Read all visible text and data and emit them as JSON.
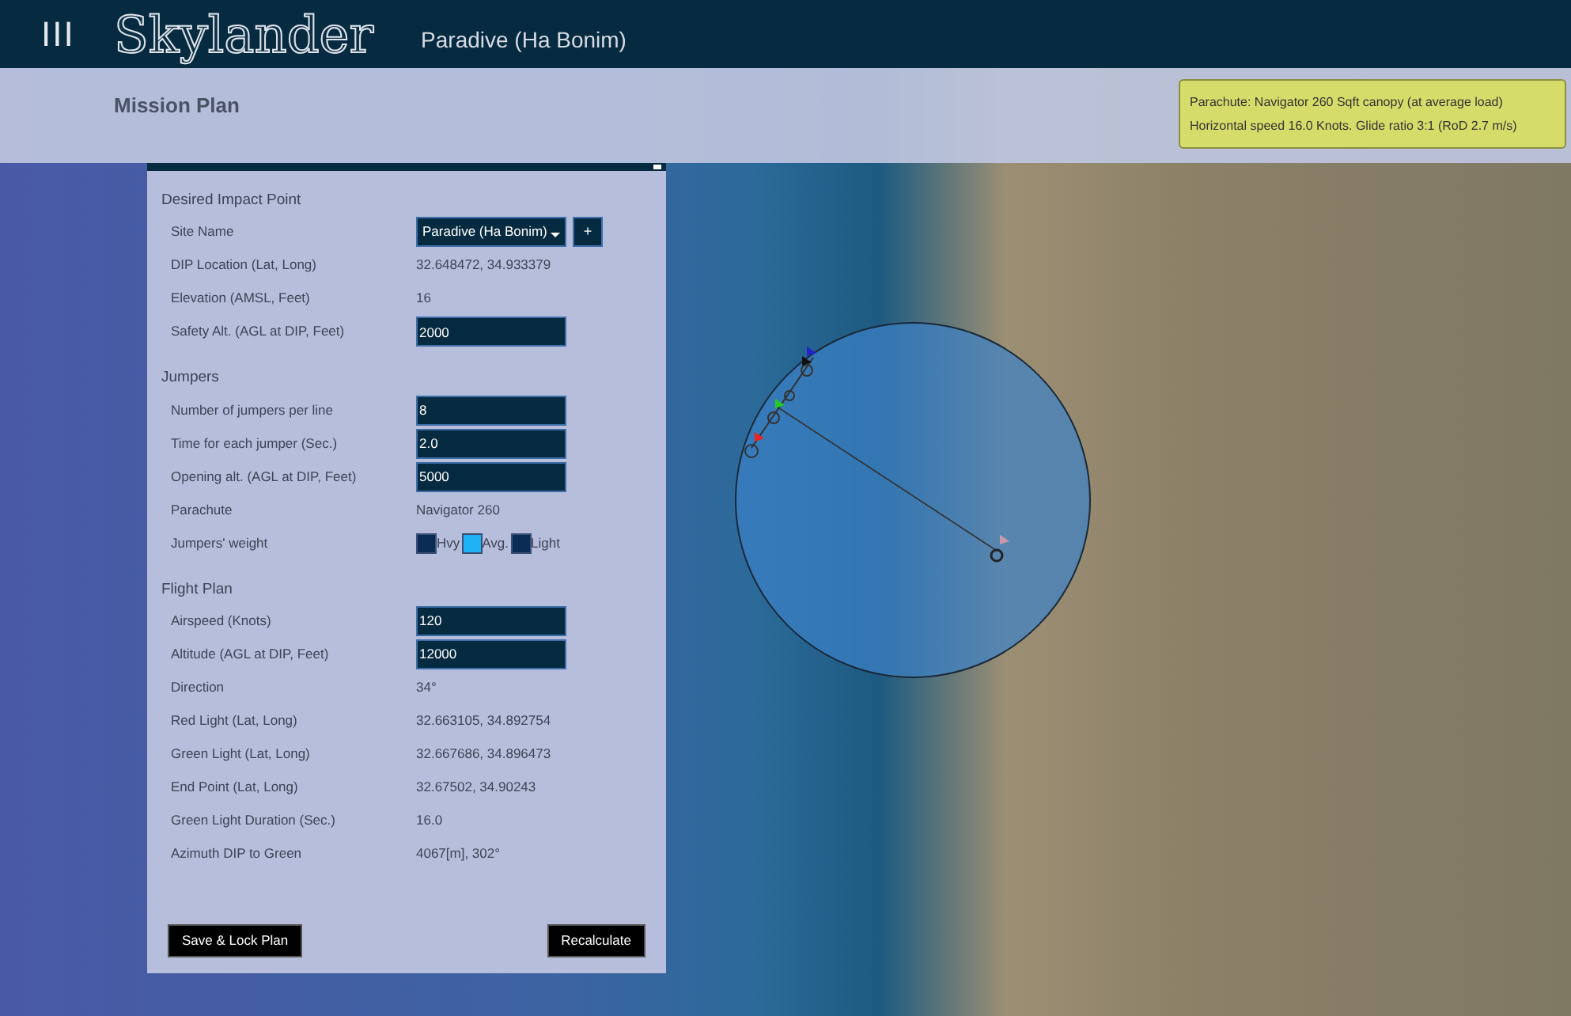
{
  "app": {
    "logo": "Skylander",
    "site": "Paradive (Ha Bonim)",
    "menu_glyph": "III"
  },
  "header": {
    "title": "Mission Plan"
  },
  "tooltip": {
    "lines": [
      "Parachute: Navigator 260 Sqft canopy (at average load)",
      "Horizontal speed 16.0 Knots. Glide ratio 3:1 (RoD 2.7 m/s)"
    ]
  },
  "sections": [
    {
      "title": "Desired Impact Point",
      "rows": [
        {
          "kind": "select",
          "label": "Site Name",
          "value": "Paradive (Ha Bonim)",
          "add_button": "+"
        },
        {
          "kind": "static",
          "label": "DIP Location (Lat, Long)",
          "value": "32.648472, 34.933379"
        },
        {
          "kind": "static",
          "label": "Elevation (AMSL, Feet)",
          "value": "16"
        },
        {
          "kind": "input",
          "label": "Safety Alt. (AGL at DIP, Feet)",
          "value": "2000"
        }
      ]
    },
    {
      "title": "Jumpers",
      "rows": [
        {
          "kind": "input",
          "label": "Number of jumpers per line",
          "value": "8"
        },
        {
          "kind": "input",
          "label": "Time for each jumper (Sec.)",
          "value": "2.0"
        },
        {
          "kind": "input",
          "label": "Opening alt. (AGL at DIP, Feet)",
          "value": "5000"
        },
        {
          "kind": "static",
          "label": "Parachute",
          "value": "Navigator 260"
        },
        {
          "kind": "weights",
          "label": "Jumpers' weight",
          "options": [
            {
              "label": "Hvy",
              "selected": false
            },
            {
              "label": "Avg.",
              "selected": true
            },
            {
              "label": "Light",
              "selected": false
            }
          ]
        }
      ]
    },
    {
      "title": "Flight Plan",
      "rows": [
        {
          "kind": "input",
          "label": "Airspeed (Knots)",
          "value": "120"
        },
        {
          "kind": "input",
          "label": "Altitude (AGL at DIP, Feet)",
          "value": "12000"
        },
        {
          "kind": "static",
          "label": "Direction",
          "value": "34°"
        },
        {
          "kind": "static",
          "label": "Red Light (Lat, Long)",
          "value": "32.663105, 34.892754"
        },
        {
          "kind": "static",
          "label": "Green Light (Lat, Long)",
          "value": "32.667686, 34.896473"
        },
        {
          "kind": "static",
          "label": "End Point (Lat, Long)",
          "value": "32.67502, 34.90243"
        },
        {
          "kind": "static",
          "label": "Green Light Duration (Sec.)",
          "value": "16.0"
        },
        {
          "kind": "static",
          "label": "Azimuth DIP to Green",
          "value": "4067[m], 302°"
        }
      ]
    }
  ],
  "buttons": [
    {
      "label": "Save & Lock Plan"
    },
    {
      "label": "Recalculate"
    }
  ]
}
